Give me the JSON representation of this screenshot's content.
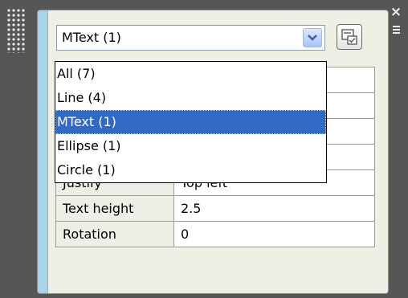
{
  "window": {
    "close_glyph": "×"
  },
  "filter": {
    "selected": "MText (1)",
    "options": [
      {
        "label": "All (7)",
        "selected": false
      },
      {
        "label": "Line (4)",
        "selected": false
      },
      {
        "label": "MText (1)",
        "selected": true
      },
      {
        "label": "Ellipse (1)",
        "selected": false
      },
      {
        "label": "Circle (1)",
        "selected": false
      }
    ]
  },
  "properties": [
    {
      "name": "",
      "value": ""
    },
    {
      "name": "",
      "value": ""
    },
    {
      "name": "",
      "value": ""
    },
    {
      "name": "",
      "value": ""
    },
    {
      "name": "Justify",
      "value": "Top left"
    },
    {
      "name": "Text height",
      "value": "2.5"
    },
    {
      "name": "Rotation",
      "value": "0"
    }
  ],
  "colors": {
    "selection": "#316ac5",
    "side_strip": "#a9d3e6",
    "frame": "#565656"
  }
}
